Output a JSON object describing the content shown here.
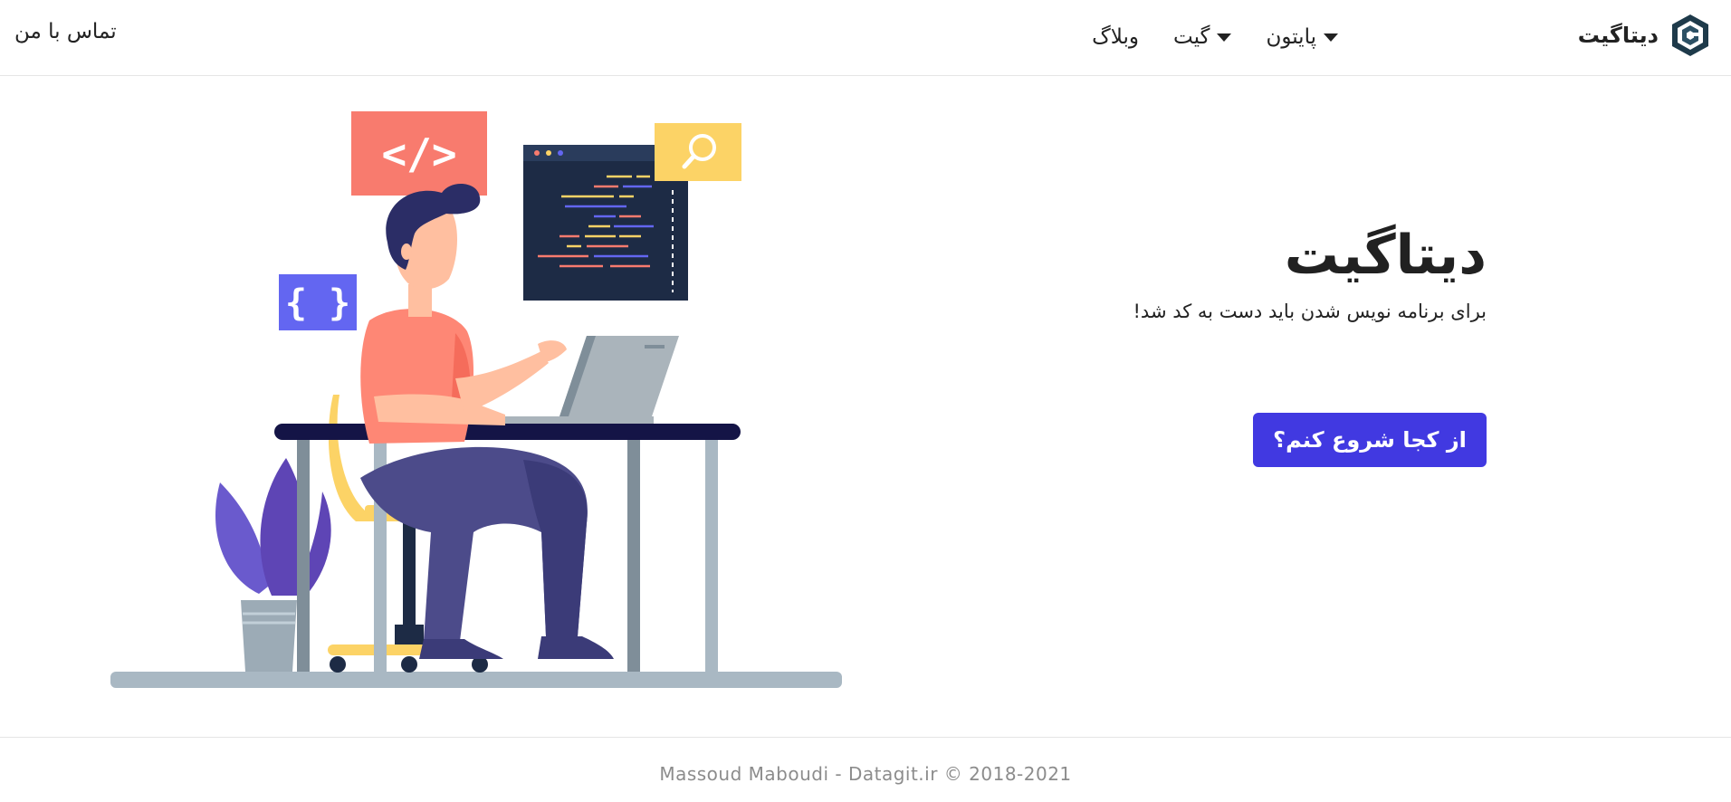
{
  "navbar": {
    "brand_name": "دیتاگیت",
    "menu": [
      {
        "label": "پایتون",
        "has_dropdown": true
      },
      {
        "label": "گیت",
        "has_dropdown": true
      },
      {
        "label": "وبلاگ",
        "has_dropdown": false
      }
    ],
    "contact_label": "تماس با من"
  },
  "hero": {
    "title": "دیتاگیت",
    "subtitle": "برای برنامه نویس شدن باید دست به کد شد!",
    "cta_label": "از کجا شروع کنم؟",
    "illustration": {
      "code_tag_glyph": "</>",
      "braces_glyph": "{ }"
    }
  },
  "footer": {
    "text": "Massoud Maboudi - Datagit.ir © 2018-2021"
  },
  "colors": {
    "accent": "#4139e1",
    "code_tag_bg": "#f87b6e",
    "braces_bg": "#6366f1",
    "search_bg": "#fcd366",
    "editor_bg": "#1d2b45",
    "shirt": "#fe8775",
    "pants": "#4c4b8a",
    "desk_top": "#141446",
    "leaf": "#5e45b5"
  }
}
